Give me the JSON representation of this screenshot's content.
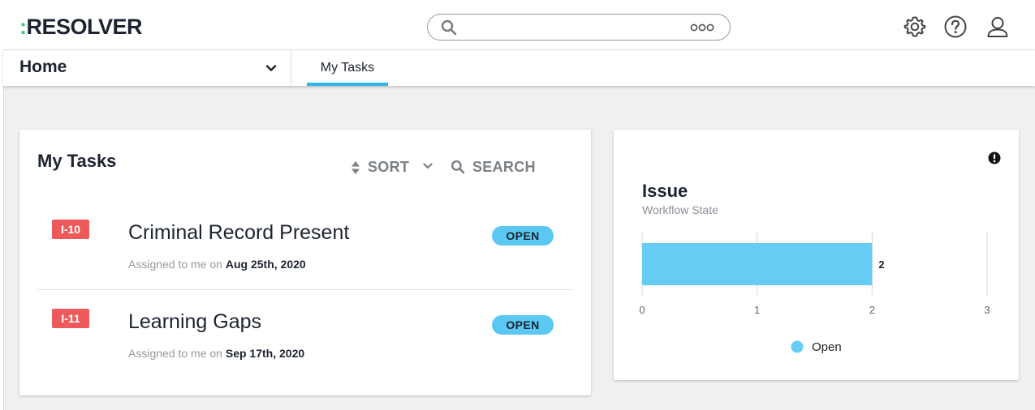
{
  "header": {
    "logo_prefix": ":",
    "logo_text": "RESOLVER",
    "search_placeholder": ""
  },
  "nav": {
    "selected": "Home",
    "tabs": [
      {
        "label": "My Tasks",
        "active": true
      }
    ]
  },
  "tasks_card": {
    "title": "My Tasks",
    "sort_label": "SORT",
    "search_label": "SEARCH",
    "meta_prefix": "Assigned to me on",
    "items": [
      {
        "id": "I-10",
        "title": "Criminal Record Present",
        "date": "Aug 25th, 2020",
        "status": "OPEN"
      },
      {
        "id": "I-11",
        "title": "Learning Gaps",
        "date": "Sep 17th, 2020",
        "status": "OPEN"
      }
    ]
  },
  "chart_card": {
    "title": "Issue",
    "subtitle": "Workflow State"
  },
  "colors": {
    "accent": "#32b6e8",
    "bar": "#66ccf4",
    "badge_red": "#ee5a5c",
    "status_blue": "#5bc8f2",
    "logo_dots": "#3ec97b"
  },
  "icons": {
    "search": "search-icon",
    "more": "more-icon",
    "settings": "gear-icon",
    "help": "help-icon",
    "user": "user-icon",
    "dropdown": "chevron-down-icon",
    "sort": "sort-icon",
    "info": "info-icon"
  },
  "chart_data": {
    "type": "bar",
    "orientation": "horizontal",
    "categories": [
      "Open"
    ],
    "series": [
      {
        "name": "Open",
        "values": [
          2
        ]
      }
    ],
    "data_labels": [
      "2"
    ],
    "xlim": [
      0,
      3
    ],
    "xticks": [
      "0",
      "1",
      "2",
      "3"
    ],
    "grid": true,
    "legend": "bottom-center"
  }
}
